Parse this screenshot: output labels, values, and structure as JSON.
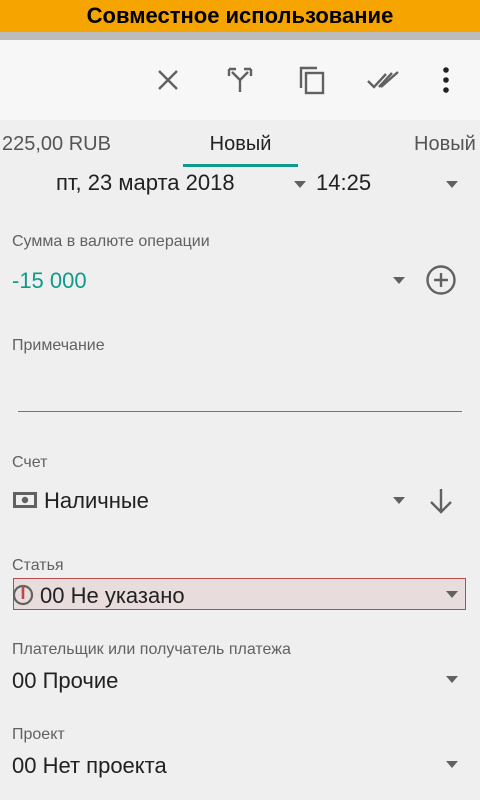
{
  "banner": {
    "text": "Совместное использование"
  },
  "toolbar": {
    "icons": [
      "close-icon",
      "merge-split-icon",
      "copy-icon",
      "done-all-icon",
      "more-vert-icon"
    ]
  },
  "tabs": [
    {
      "label": "225,00 RUB"
    },
    {
      "label": "Новый"
    },
    {
      "label": "Новый"
    }
  ],
  "datetime": {
    "date": "пт, 23 марта 2018",
    "time": "14:25"
  },
  "amount": {
    "label": "Сумма в валюте операции",
    "value": "-15 000"
  },
  "note": {
    "label": "Примечание",
    "value": ""
  },
  "account": {
    "label": "Счет",
    "value": "Наличные"
  },
  "article": {
    "label": "Статья",
    "value": "00 Не указано"
  },
  "payer": {
    "label": "Плательщик или получатель платежа",
    "value": "00 Прочие"
  },
  "project": {
    "label": "Проект",
    "value": "00 Нет проекта"
  },
  "colors": {
    "accent": "#0e9b8c",
    "banner": "#f5a400",
    "error": "#b84a4a"
  }
}
